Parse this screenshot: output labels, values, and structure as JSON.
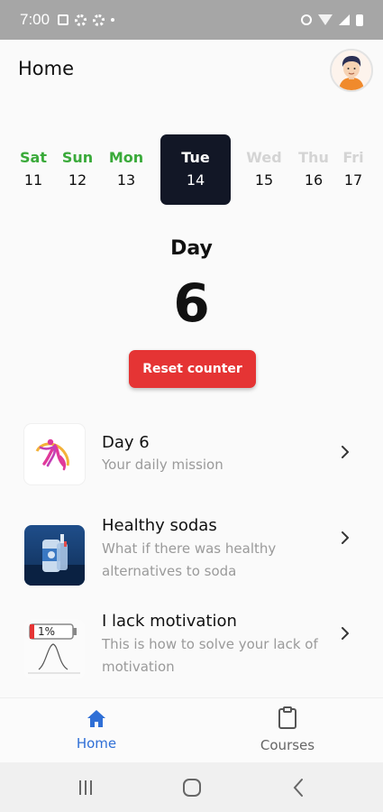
{
  "status_bar": {
    "time": "7:00",
    "left_icons": [
      "image-icon",
      "settings-icon",
      "gear-icon",
      "dot-icon"
    ],
    "right_icons": [
      "alarm-icon",
      "wifi-icon",
      "signal-icon",
      "battery-icon"
    ]
  },
  "header": {
    "title": "Home",
    "avatar": "avatar-icon"
  },
  "week": {
    "days": [
      {
        "name": "Sat",
        "num": "11",
        "state": "past"
      },
      {
        "name": "Sun",
        "num": "12",
        "state": "past"
      },
      {
        "name": "Mon",
        "num": "13",
        "state": "past"
      },
      {
        "name": "Tue",
        "num": "14",
        "state": "selected"
      },
      {
        "name": "Wed",
        "num": "15",
        "state": "future"
      },
      {
        "name": "Thu",
        "num": "16",
        "state": "future"
      },
      {
        "name": "Fri",
        "num": "17",
        "state": "future"
      }
    ]
  },
  "counter": {
    "label": "Day",
    "value": "6",
    "reset_label": "Reset counter"
  },
  "list": {
    "items": [
      {
        "title": "Day 6",
        "subtitle": "Your daily mission",
        "thumb": "gymnast-logo-image"
      },
      {
        "title": "Healthy sodas",
        "subtitle": "What if there was healthy alternatives to soda",
        "thumb": "soda-can-image"
      },
      {
        "title": "I lack motivation",
        "subtitle": "This is how to solve your lack of motivation",
        "thumb": "low-battery-motivation-image",
        "thumb_text": "1%"
      }
    ]
  },
  "bottom_nav": {
    "items": [
      {
        "label": "Home",
        "icon": "home-icon",
        "active": true
      },
      {
        "label": "Courses",
        "icon": "clipboard-icon",
        "active": false
      }
    ]
  },
  "system_nav": [
    "recents-button",
    "home-button",
    "back-button"
  ],
  "colors": {
    "accent": "#2f6fd6",
    "selected_day_bg": "#121726",
    "past_day": "#3aaa3a",
    "future_day": "#d4d4d4",
    "reset_button": "#e53434"
  }
}
